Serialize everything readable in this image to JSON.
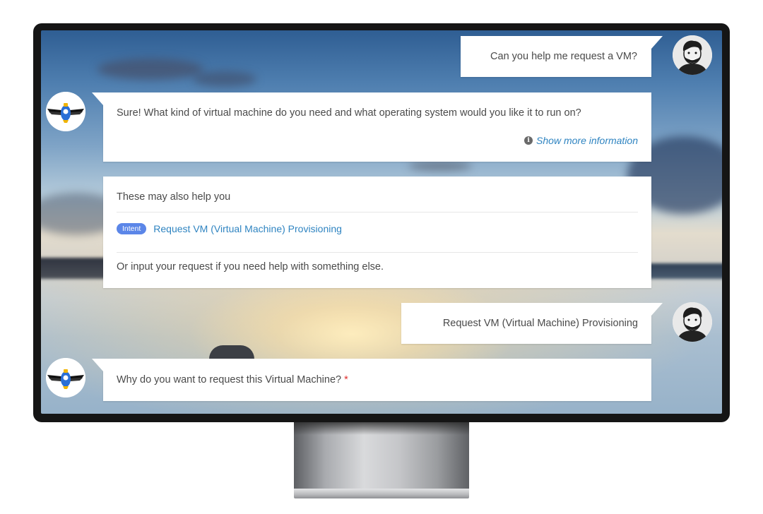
{
  "conversation": {
    "user_message_1": "Can you help me request a VM?",
    "bot_message_1": "Sure! What kind of virtual machine do you need and what operating system would you like it to run on?",
    "show_more_label": "Show more information",
    "suggestions": {
      "heading": "These may also help you",
      "badge": "Intent",
      "link": "Request VM (Virtual Machine) Provisioning",
      "footer": "Or input your request if you need help with something else."
    },
    "user_message_2": "Request VM (Virtual Machine) Provisioning",
    "bot_message_2": "Why do you want to request this Virtual Machine?",
    "required_mark": "*"
  },
  "icons": {
    "user_avatar": "user-avatar-icon",
    "bot_avatar": "bot-avatar-icon",
    "info": "info-icon"
  },
  "colors": {
    "link": "#2f84c1",
    "badge": "#5b86e8",
    "required": "#e0312f",
    "bubble": "#ffffff"
  }
}
